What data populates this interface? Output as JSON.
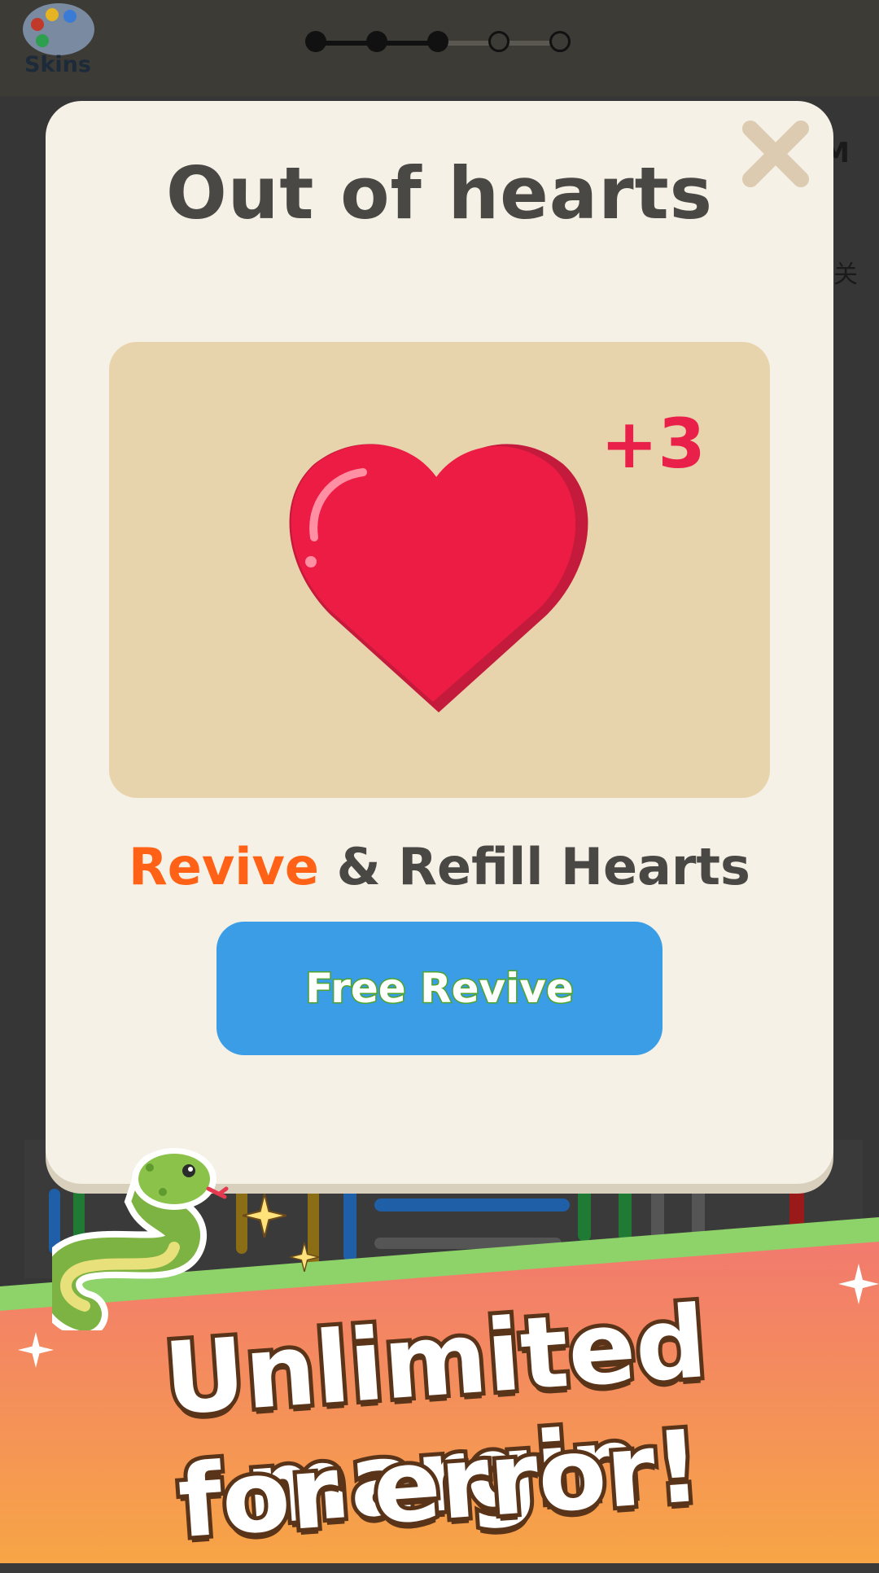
{
  "header": {
    "skins_label": "Skins",
    "level_progress": {
      "total_steps": 5,
      "completed_steps": 3
    }
  },
  "background": {
    "side_text_1": "M",
    "side_text_2": "关"
  },
  "modal": {
    "title": "Out of hearts",
    "reward_amount": "+3",
    "revive_highlight": "Revive",
    "revive_rest": " & Refill Hearts",
    "free_revive_label": "Free Revive",
    "colors": {
      "accent_orange": "#ff6216",
      "heart_red": "#e8204a",
      "button_blue": "#3a9de6",
      "panel_tan": "#e8d4ac",
      "modal_bg": "#f5f1e6"
    }
  },
  "promo": {
    "line1": "Unlimited margin",
    "line2": "for error!"
  }
}
